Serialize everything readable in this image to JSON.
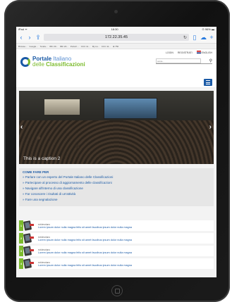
{
  "statusbar": {
    "carrier": "iPad ᯤ",
    "time": "18:30",
    "battery": "⊙ 96% ▬"
  },
  "browser": {
    "url": "172.22.35.45",
    "bookmarks": [
      "Browse...",
      "Google...",
      "Tenda...",
      "IBC 20...",
      "IBC 20...",
      "Portal I...",
      "CCC 11...",
      "My isi...",
      "CCC 11...",
      "⊕ 750"
    ]
  },
  "header": {
    "links": {
      "login": "LOGIN",
      "registrati": "REGISTRATI",
      "lang": "ENGLISH"
    },
    "logo": {
      "word1": "Portale",
      "word2": "Italiano",
      "word3": "delle",
      "word4": "Classificazioni"
    },
    "search_placeholder": "cerca..."
  },
  "carousel": {
    "caption": "This is a caption 2",
    "prev": "‹",
    "next": "›"
  },
  "howto": {
    "title": "COME FARE PER",
    "links": [
      "» Parlare con un esperto del Portale Italiano delle Classificazioni",
      "» Partecipare al processo di aggiornamento delle classificazioni",
      "» Navigare all'interno di una classificazione",
      "» Far conoscere i risultati di un'attività",
      "» Fare una segnalazione"
    ]
  },
  "news": [
    {
      "num": "1",
      "tag": "evidenziano",
      "desc": "Lorem ipsum dolor nulla magna felis sit amet faucibus ipsum dolor nulla magna"
    },
    {
      "num": "2",
      "tag": "evidenziano",
      "desc": "Lorem ipsum dolor nulla magna felis sit amet faucibus ipsum dolor nulla magna"
    },
    {
      "num": "3",
      "tag": "evidenziano",
      "desc": "Lorem ipsum dolor nulla magna felis sit amet faucibus ipsum dolor nulla magna"
    },
    {
      "num": "4",
      "tag": "evidenziano",
      "desc": "Lorem ipsum dolor nulla magna felis sit amet faucibus ipsum dolor nulla magna"
    }
  ],
  "colors": {
    "brand_blue": "#1a5aa6",
    "brand_green": "#7cbb2d"
  }
}
